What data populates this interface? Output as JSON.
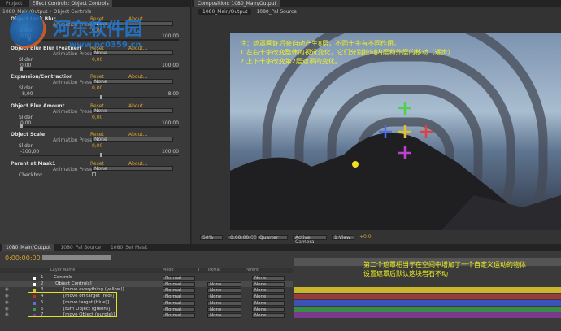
{
  "left_panel": {
    "tabs": [
      "Project",
      "Effect Controls: Object Controls"
    ],
    "breadcrumb": "1080_Main/Output • Object Controls",
    "watermark": {
      "name": "河东软件园",
      "url": "www.pc0359.cn"
    },
    "preset_label": "Animation Presets:",
    "preset_value": "None",
    "reset": "Reset",
    "about": "About...",
    "slider_label": "Slider",
    "checkbox_label": "Checkbox",
    "effects": [
      {
        "title": "Object Lock Blur",
        "value": "0,00",
        "min": "0,00",
        "max": "100,00",
        "knob": 0.05
      },
      {
        "title": "Object Blur Blur (Feather)",
        "value": "0,00",
        "min": "0,00",
        "max": "100,00",
        "knob": 0.0
      },
      {
        "title": "Expansion/Contraction",
        "value": "0,00",
        "min": "-8,00",
        "max": "8,00",
        "knob": 0.5
      },
      {
        "title": "Object Blur Amount",
        "value": "0,00",
        "min": "0,00",
        "max": "100,00",
        "knob": 0.0
      },
      {
        "title": "Object Scale",
        "value": "0,00",
        "min": "-100,00",
        "max": "100,00",
        "knob": 0.5
      },
      {
        "title": "Parent at Mask1"
      }
    ]
  },
  "comp": {
    "tab": "Composition: 1080_Main/Output",
    "subtabs": [
      "1080_Main/Output",
      "1080_Pal Source"
    ],
    "annotation": [
      "注：遮罩画好后会自动产生8层，不同十字有不同作用。",
      "1.左右十字改变整体的视觉变化，它们分别控制内层和外层的移动（逐步）",
      "2.上下十字改变第2层遮罩的变化。"
    ],
    "toolbar": {
      "zoom": "50%",
      "time": "0:00:00:00",
      "resolution": "Quarter",
      "camera": "Active Camera",
      "view": "1 View",
      "exposure": "+0,0"
    }
  },
  "timeline": {
    "tabs": [
      "1080_Main/Output",
      "1080_Pal Source",
      "1080_Set Mask"
    ],
    "timecode": "0:00:00:00",
    "headers": {
      "layer_name": "Layer Name",
      "mode": "Mode",
      "t": "T",
      "trkmat": "TrkMat",
      "parent": "Parent"
    },
    "layers": [
      {
        "num": "1",
        "name": "Controls",
        "color": "#ffffff",
        "mode": "Normal",
        "trkmat": "",
        "parent": "None"
      },
      {
        "num": "2",
        "name": "[Object Controls]",
        "color": "#ffffff",
        "mode": "Normal",
        "trkmat": "None",
        "parent": "None"
      },
      {
        "num": "3",
        "name": "[move everything (yellow)]",
        "color": "#d8c830",
        "mode": "Normal",
        "trkmat": "None",
        "parent": "None",
        "bar": "#c9b52e"
      },
      {
        "num": "4",
        "name": "[move off target (red)]",
        "color": "#c03030",
        "mode": "Normal",
        "trkmat": "None",
        "parent": "None",
        "bar": "#9a3b3b"
      },
      {
        "num": "5",
        "name": "[move target (blue)]",
        "color": "#6070d8",
        "mode": "Normal",
        "trkmat": "None",
        "parent": "None",
        "bar": "#3c52b8"
      },
      {
        "num": "6",
        "name": "[turn Object (green)]",
        "color": "#30a040",
        "mode": "Normal",
        "trkmat": "None",
        "parent": "None",
        "bar": "#3a8a4a"
      },
      {
        "num": "7",
        "name": "[move Object (purple)]",
        "color": "#9030a0",
        "mode": "Normal",
        "trkmat": "None",
        "parent": "None",
        "bar": "#7a3a8c"
      }
    ],
    "annotation": [
      "第二个遮罩相当于在空间中增加了一个自定义运动的物体",
      "设置遮罩后默认这块岩石不动"
    ]
  }
}
